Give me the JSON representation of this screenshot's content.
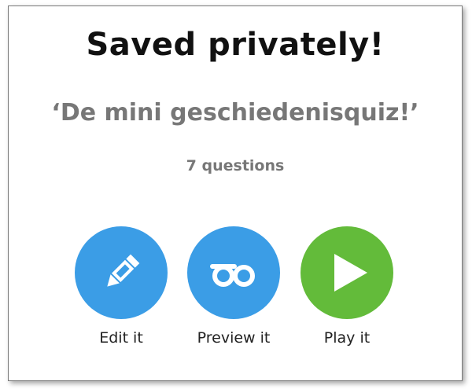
{
  "title": "Saved privately!",
  "quiz_name": "‘De mini geschiedenisquiz!’",
  "question_count": "7 questions",
  "actions": [
    {
      "label": "Edit it",
      "icon": "pencil-icon",
      "color": "#3b9de6"
    },
    {
      "label": "Preview it",
      "icon": "glasses-icon",
      "color": "#3b9de6"
    },
    {
      "label": "Play it",
      "icon": "play-icon",
      "color": "#63bb3a"
    }
  ]
}
